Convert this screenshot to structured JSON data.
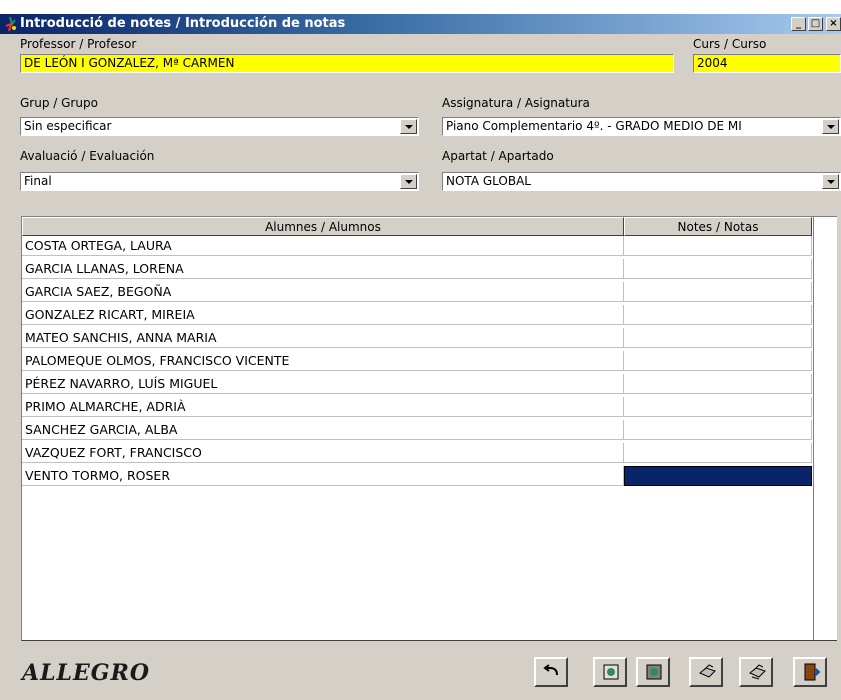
{
  "window": {
    "title": "Introducció de notes / Introducción de notas",
    "controls": [
      "minimize",
      "maximize",
      "close"
    ]
  },
  "form": {
    "professor_label": "Professor / Profesor",
    "professor_value": "DE LEÓN I GONZALEZ, Mª CARMEN",
    "curs_label": "Curs / Curso",
    "curs_value": "2004",
    "grup_label": "Grup / Grupo",
    "grup_value": "Sin especificar",
    "assignatura_label": "Assignatura / Asignatura",
    "assignatura_value": "Piano Complementario 4º. - GRADO MEDIO DE MI",
    "avaluacio_label": "Avaluació / Evaluación",
    "avaluacio_value": "Final",
    "apartat_label": "Apartat / Apartado",
    "apartat_value": "NOTA GLOBAL"
  },
  "grid": {
    "columns": [
      "Alumnes / Alumnos",
      "Notes / Notas"
    ],
    "rows": [
      {
        "name": "COSTA ORTEGA, LAURA",
        "note": ""
      },
      {
        "name": "GARCIA LLANAS, LORENA",
        "note": ""
      },
      {
        "name": "GARCIA SAEZ, BEGOÑA",
        "note": ""
      },
      {
        "name": "GONZALEZ RICART, MIREIA",
        "note": ""
      },
      {
        "name": "MATEO SANCHIS, ANNA MARIA",
        "note": ""
      },
      {
        "name": "PALOMEQUE OLMOS, FRANCISCO VICENTE",
        "note": ""
      },
      {
        "name": "PÉREZ NAVARRO, LUÍS MIGUEL",
        "note": ""
      },
      {
        "name": "PRIMO ALMARCHE, ADRIÀ",
        "note": ""
      },
      {
        "name": "SANCHEZ GARCIA, ALBA",
        "note": ""
      },
      {
        "name": "VAZQUEZ FORT, FRANCISCO",
        "note": ""
      },
      {
        "name": "VENTO TORMO, ROSER",
        "note": ""
      }
    ],
    "selected_row": 10
  },
  "footer": {
    "logo_text": "ALLEGRO",
    "buttons": [
      "undo-icon",
      "save-green-icon",
      "save-grey-icon",
      "print-icon",
      "print-all-icon",
      "exit-door-icon"
    ]
  },
  "colors": {
    "title_gradient_start": "#0a246a",
    "highlight_yellow": "#ffff00",
    "selection": "#0a246a",
    "window_bg": "#d4d0c8"
  }
}
